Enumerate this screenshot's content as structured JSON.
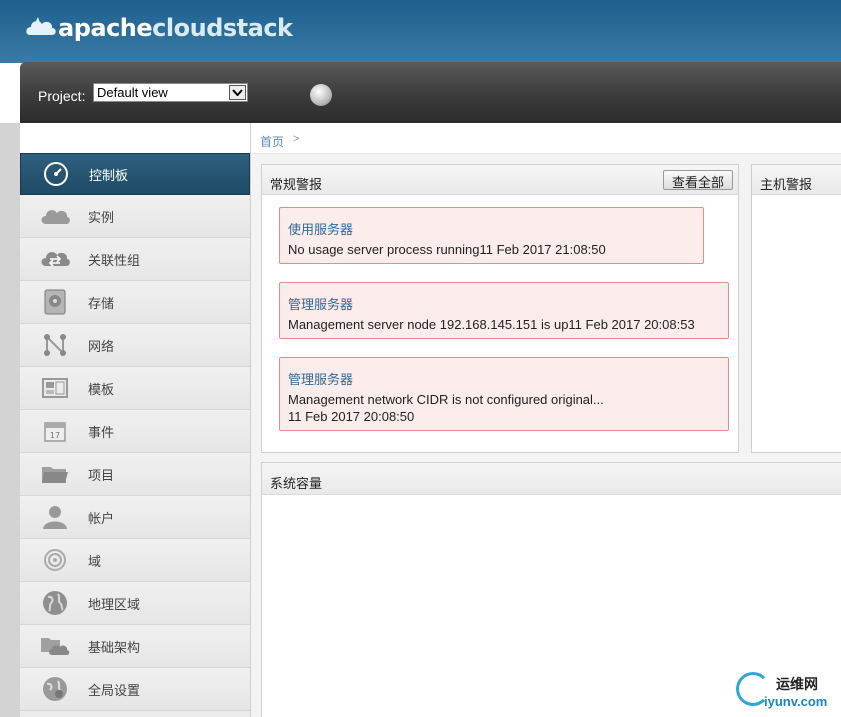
{
  "header": {
    "logo_text_a": "apache",
    "logo_text_b": "cloudstack"
  },
  "project": {
    "label": "Project:",
    "selected": "Default view"
  },
  "sidebar": {
    "items": [
      {
        "label": "控制板",
        "icon": "dashboard-icon"
      },
      {
        "label": "实例",
        "icon": "cloud-icon"
      },
      {
        "label": "关联性组",
        "icon": "cloud-sync-icon"
      },
      {
        "label": "存储",
        "icon": "disk-icon"
      },
      {
        "label": "网络",
        "icon": "network-icon"
      },
      {
        "label": "模板",
        "icon": "template-icon"
      },
      {
        "label": "事件",
        "icon": "calendar-icon"
      },
      {
        "label": "项目",
        "icon": "folder-icon"
      },
      {
        "label": "帐户",
        "icon": "user-icon"
      },
      {
        "label": "域",
        "icon": "domain-icon"
      },
      {
        "label": "地理区域",
        "icon": "globe-icon"
      },
      {
        "label": "基础架构",
        "icon": "infrastructure-icon"
      },
      {
        "label": "全局设置",
        "icon": "global-settings-icon"
      }
    ]
  },
  "breadcrumb": {
    "home": "首页",
    "sep": ">"
  },
  "general_alerts": {
    "title": "常规警报",
    "view_all": "查看全部",
    "alerts": [
      {
        "title": "使用服务器",
        "msg1": "No usage server process running11 Feb 2017 21:08:50",
        "msg2": ""
      },
      {
        "title": "管理服务器",
        "msg1": "Management server node 192.168.145.151 is up11 Feb 2017 20:08:53",
        "msg2": ""
      },
      {
        "title": "管理服务器",
        "msg1": "Management network CIDR is not configured original...",
        "msg2": "11 Feb 2017 20:08:50"
      }
    ]
  },
  "host_alerts": {
    "title": "主机警报"
  },
  "capacity": {
    "title": "系统容量"
  },
  "watermark": {
    "line1": "运维网",
    "line2": "iyunv.com"
  },
  "colors": {
    "header_blue": "#2d6e9b",
    "active_nav": "#1e4b66",
    "alert_bg": "#fdecec",
    "alert_border": "#e58c8c",
    "link_blue": "#2e6a99"
  }
}
